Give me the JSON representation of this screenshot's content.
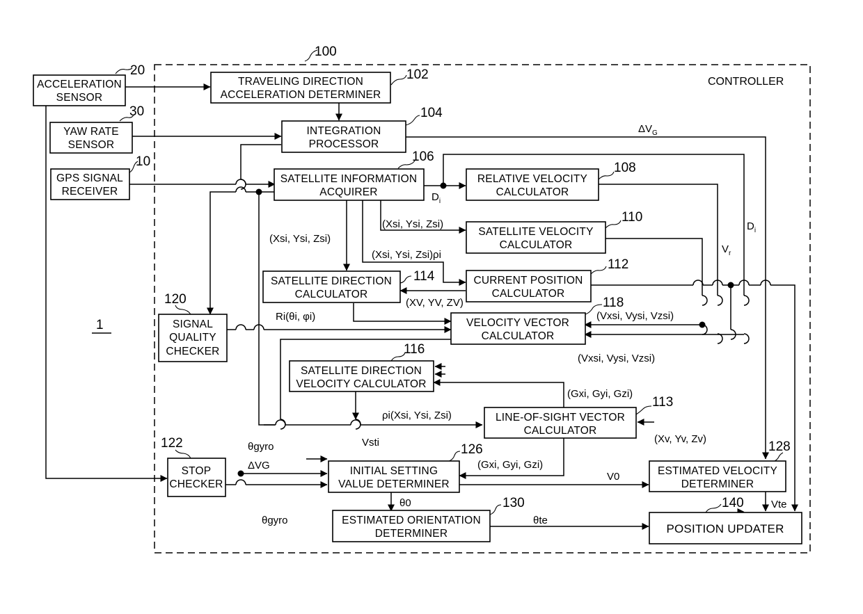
{
  "figure": {
    "system_ref": "1",
    "controller": {
      "ref": "100",
      "label": "CONTROLLER"
    }
  },
  "blocks": {
    "acceleration_sensor": {
      "ref": "20",
      "lines": [
        "ACCELERATION",
        "SENSOR"
      ]
    },
    "yaw_rate_sensor": {
      "ref": "30",
      "lines": [
        "YAW RATE",
        "SENSOR"
      ]
    },
    "gps_signal_receiver": {
      "ref": "10",
      "lines": [
        "GPS SIGNAL",
        "RECEIVER"
      ]
    },
    "traveling_direction_acceleration_determiner": {
      "ref": "102",
      "lines": [
        "TRAVELING DIRECTION",
        "ACCELERATION DETERMINER"
      ]
    },
    "integration_processor": {
      "ref": "104",
      "lines": [
        "INTEGRATION",
        "PROCESSOR"
      ]
    },
    "satellite_information_acquirer": {
      "ref": "106",
      "lines": [
        "SATELLITE INFORMATION",
        "ACQUIRER"
      ]
    },
    "relative_velocity_calculator": {
      "ref": "108",
      "lines": [
        "RELATIVE VELOCITY",
        "CALCULATOR"
      ]
    },
    "satellite_velocity_calculator": {
      "ref": "110",
      "lines": [
        "SATELLITE VELOCITY",
        "CALCULATOR"
      ]
    },
    "current_position_calculator": {
      "ref": "112",
      "lines": [
        "CURRENT POSITION",
        "CALCULATOR"
      ]
    },
    "satellite_direction_calculator": {
      "ref": "114",
      "lines": [
        "SATELLITE DIRECTION",
        "CALCULATOR"
      ]
    },
    "velocity_vector_calculator": {
      "ref": "118",
      "lines": [
        "VELOCITY VECTOR",
        "CALCULATOR"
      ]
    },
    "signal_quality_checker": {
      "ref": "120",
      "lines": [
        "SIGNAL",
        "QUALITY",
        "CHECKER"
      ]
    },
    "satellite_direction_velocity_calculator": {
      "ref": "116",
      "lines": [
        "SATELLITE DIRECTION",
        "VELOCITY CALCULATOR"
      ]
    },
    "line_of_sight_vector_calculator": {
      "ref": "113",
      "lines": [
        "LINE-OF-SIGHT VECTOR",
        "CALCULATOR"
      ]
    },
    "stop_checker": {
      "ref": "122",
      "lines": [
        "STOP",
        "CHECKER"
      ]
    },
    "initial_setting_value_determiner": {
      "ref": "126",
      "lines": [
        "INITIAL SETTING",
        "VALUE DETERMINER"
      ]
    },
    "estimated_velocity_determiner": {
      "ref": "128",
      "lines": [
        "ESTIMATED VELOCITY",
        "DETERMINER"
      ]
    },
    "estimated_orientation_determiner": {
      "ref": "130",
      "lines": [
        "ESTIMATED ORIENTATION",
        "DETERMINER"
      ]
    },
    "position_updater": {
      "ref": "140",
      "lines": [
        "POSITION UPDATER"
      ]
    }
  },
  "signals": {
    "delta_vg_top": {
      "main": "ΔV",
      "sub": "G"
    },
    "di_acq": {
      "main": "D",
      "sub": "i"
    },
    "di_right": {
      "main": "D",
      "sub": "i"
    },
    "vr": {
      "main": "V",
      "sub": "r"
    },
    "sat_pos_to_svc": "(Xsi, Ysi, Zsi)",
    "sat_pos_to_sdc": "(Xsi, Ysi, Zsi)",
    "sat_pos_rho_to_cpc": "(Xsi, Ysi, Zsi)ρi",
    "vehicle_pos_to_sdc": "(XV, YV, ZV)",
    "ri_angles": "Ri(θi, φi)",
    "sat_vel_to_vvc": "(Vxsi, Vysi, Vzsi)",
    "sat_vel_to_sdvc": "(Vxsi, Vysi, Vzsi)",
    "los_to_sdvc": "(Gxi, Gyi, Gzi)",
    "rho_pos_to_los": "ρi(Xsi, Ysi, Zsi)",
    "vehicle_pos_to_los": "(Xv, Yv, Zv)",
    "vst": "Vsti",
    "theta_gyro_upper": "θgyro",
    "delta_vg_lower": "ΔVG",
    "los_to_isvd": "(Gxi, Gyi, Gzi)",
    "v0": "V0",
    "theta0": "θ0",
    "theta_gyro_lower": "θgyro",
    "theta_te": "θte",
    "vte": "Vte"
  }
}
